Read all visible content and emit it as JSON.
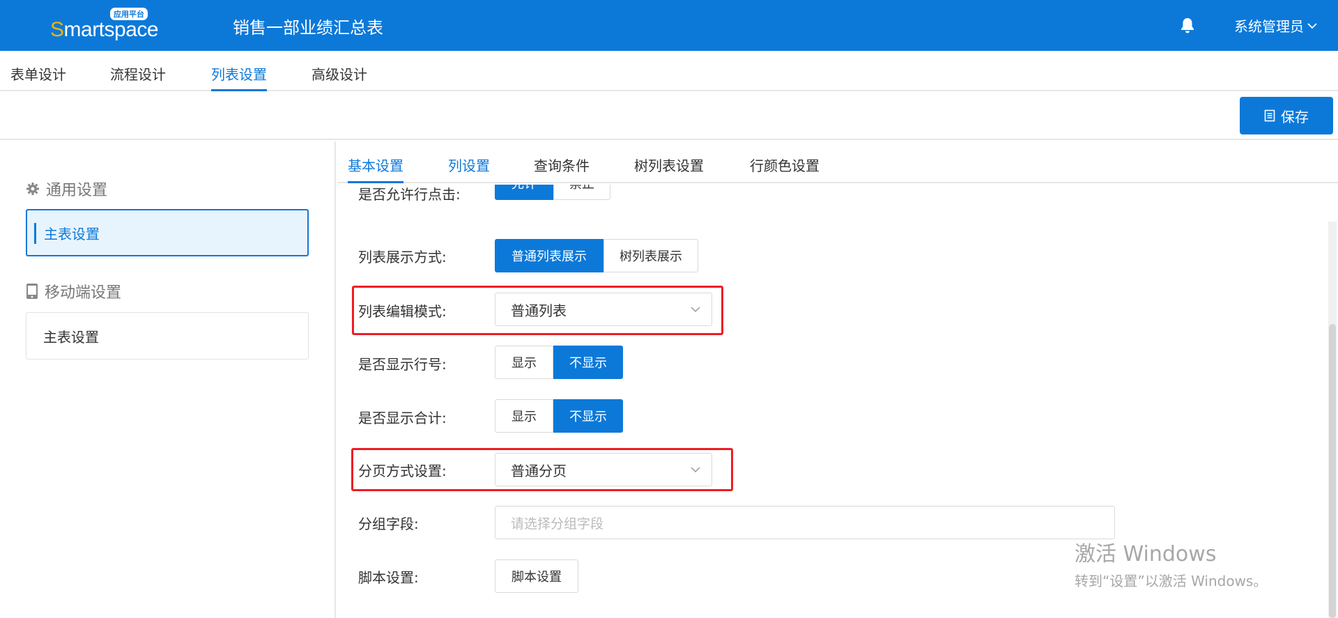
{
  "header": {
    "logo_text_first": "S",
    "logo_text_rest": "martspace",
    "logo_badge": "应用平台",
    "title": "销售一部业绩汇总表",
    "user": "系统管理员"
  },
  "design_tabs": [
    "表单设计",
    "流程设计",
    "列表设置",
    "高级设计"
  ],
  "toolbar": {
    "save_label": "保存"
  },
  "sidebar": {
    "general_title": "通用设置",
    "general_item": "主表设置",
    "mobile_title": "移动端设置",
    "mobile_item": "主表设置"
  },
  "sub_tabs": [
    "基本设置",
    "列设置",
    "查询条件",
    "树列表设置",
    "行颜色设置"
  ],
  "form": {
    "row_click": {
      "label": "是否允许行点击:",
      "options": [
        "允许",
        "禁止"
      ],
      "selected": "允许"
    },
    "display_mode": {
      "label": "列表展示方式:",
      "options": [
        "普通列表展示",
        "树列表展示"
      ],
      "selected": "普通列表展示"
    },
    "edit_mode": {
      "label": "列表编辑模式:",
      "value": "普通列表"
    },
    "show_row_number": {
      "label": "是否显示行号:",
      "options": [
        "显示",
        "不显示"
      ],
      "selected": "不显示"
    },
    "show_total": {
      "label": "是否显示合计:",
      "options": [
        "显示",
        "不显示"
      ],
      "selected": "不显示"
    },
    "paging": {
      "label": "分页方式设置:",
      "value": "普通分页"
    },
    "group_field": {
      "label": "分组字段:",
      "placeholder": "请选择分组字段"
    },
    "script": {
      "label": "脚本设置:",
      "button": "脚本设置"
    }
  },
  "watermark": {
    "line1": "激活 Windows",
    "line2": "转到“设置”以激活 Windows。"
  }
}
